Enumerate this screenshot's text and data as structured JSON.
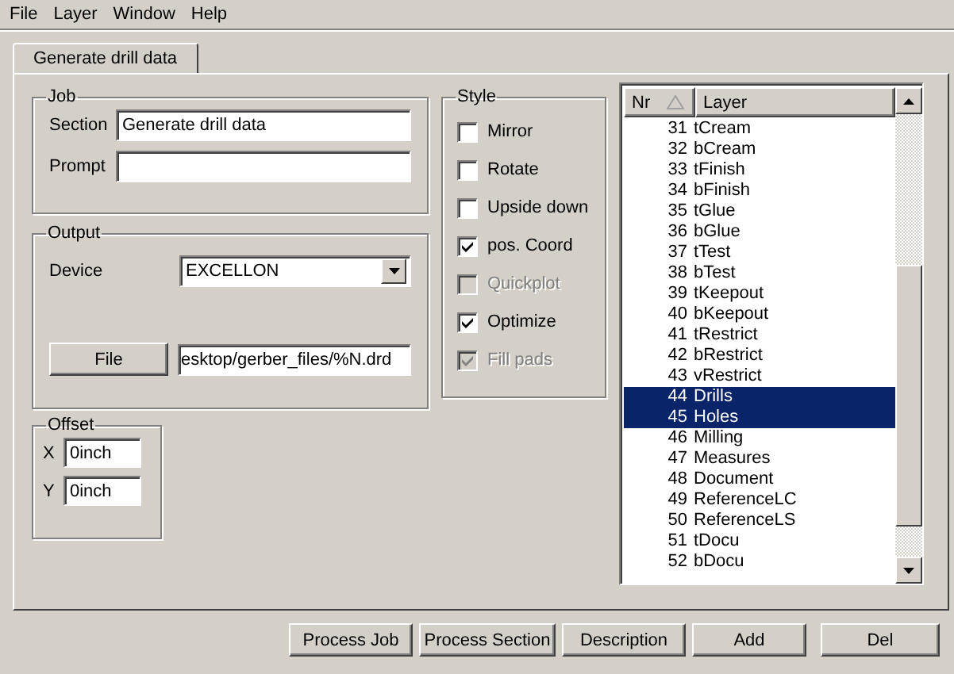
{
  "menu": [
    {
      "label": "File"
    },
    {
      "label": "Layer"
    },
    {
      "label": "Window"
    },
    {
      "label": "Help"
    }
  ],
  "tabs": [
    {
      "label": "Generate drill data",
      "selected": true
    }
  ],
  "job": {
    "title": "Job",
    "section_label": "Section",
    "section": "Generate drill data",
    "prompt_label": "Prompt"
  },
  "output": {
    "title": "Output",
    "device_label": "Device",
    "device": "EXCELLON",
    "file_button": "File",
    "file": "esktop/gerber_files/%N.drd"
  },
  "offset": {
    "title": "Offset",
    "x_label": "X",
    "x": "0inch",
    "y_label": "Y",
    "y": "0inch"
  },
  "style": {
    "title": "Style",
    "items": [
      {
        "label": "Mirror",
        "checked": false,
        "disabled": false
      },
      {
        "label": "Rotate",
        "checked": false,
        "disabled": false
      },
      {
        "label": "Upside down",
        "checked": false,
        "disabled": false
      },
      {
        "label": "pos. Coord",
        "checked": true,
        "disabled": false
      },
      {
        "label": "Quickplot",
        "checked": false,
        "disabled": true
      },
      {
        "label": "Optimize",
        "checked": true,
        "disabled": false
      },
      {
        "label": "Fill pads",
        "checked": true,
        "disabled": true
      }
    ]
  },
  "layers": {
    "columns": [
      "Nr",
      "Layer"
    ],
    "rows": [
      {
        "nr": "31",
        "name": "tCream",
        "selected": false
      },
      {
        "nr": "32",
        "name": "bCream",
        "selected": false
      },
      {
        "nr": "33",
        "name": "tFinish",
        "selected": false
      },
      {
        "nr": "34",
        "name": "bFinish",
        "selected": false
      },
      {
        "nr": "35",
        "name": "tGlue",
        "selected": false
      },
      {
        "nr": "36",
        "name": "bGlue",
        "selected": false
      },
      {
        "nr": "37",
        "name": "tTest",
        "selected": false
      },
      {
        "nr": "38",
        "name": "bTest",
        "selected": false
      },
      {
        "nr": "39",
        "name": "tKeepout",
        "selected": false
      },
      {
        "nr": "40",
        "name": "bKeepout",
        "selected": false
      },
      {
        "nr": "41",
        "name": "tRestrict",
        "selected": false
      },
      {
        "nr": "42",
        "name": "bRestrict",
        "selected": false
      },
      {
        "nr": "43",
        "name": "vRestrict",
        "selected": false
      },
      {
        "nr": "44",
        "name": "Drills",
        "selected": true
      },
      {
        "nr": "45",
        "name": "Holes",
        "selected": true
      },
      {
        "nr": "46",
        "name": "Milling",
        "selected": false
      },
      {
        "nr": "47",
        "name": "Measures",
        "selected": false
      },
      {
        "nr": "48",
        "name": "Document",
        "selected": false
      },
      {
        "nr": "49",
        "name": "ReferenceLC",
        "selected": false
      },
      {
        "nr": "50",
        "name": "ReferenceLS",
        "selected": false
      },
      {
        "nr": "51",
        "name": "tDocu",
        "selected": false
      },
      {
        "nr": "52",
        "name": "bDocu",
        "selected": false
      }
    ]
  },
  "buttons": [
    "Process Job",
    "Process Section",
    "Description",
    "Add",
    "Del"
  ]
}
